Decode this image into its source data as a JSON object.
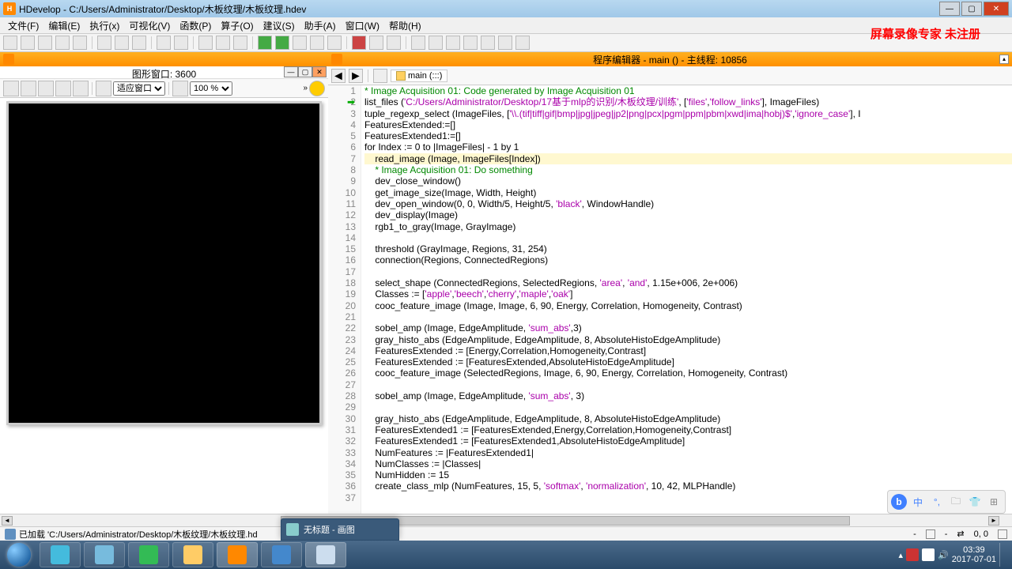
{
  "title": "HDevelop - C:/Users/Administrator/Desktop/木板纹理/木板纹理.hdev",
  "menu": [
    "文件(F)",
    "编辑(E)",
    "执行(x)",
    "可视化(V)",
    "函数(P)",
    "算子(O)",
    "建议(S)",
    "助手(A)",
    "窗口(W)",
    "帮助(H)"
  ],
  "watermark": "屏幕录像专家 未注册",
  "graphic_window": {
    "title": "图形窗口: 3600",
    "fit_label": "适应窗口",
    "zoom": "100 %"
  },
  "editor_header": "程序编辑器 - main ()  - 主线程: 10856",
  "breadcrumb": "main (:::)",
  "code_lines": [
    {
      "n": 1,
      "t": "* Image Acquisition 01: Code generated by Image Acquisition 01",
      "cls": "c-comment"
    },
    {
      "n": 2,
      "t": "list_files ('C:/Users/Administrator/Desktop/17基于mlp的识别/木板纹理/训练', ['files','follow_links'], ImageFiles)",
      "cls": ""
    },
    {
      "n": 3,
      "t": "tuple_regexp_select (ImageFiles, ['\\\\.(tif|tiff|gif|bmp|jpg|jpeg|jp2|png|pcx|pgm|ppm|pbm|xwd|ima|hobj)$','ignore_case'], I",
      "cls": ""
    },
    {
      "n": 4,
      "t": "FeaturesExtended:=[]",
      "cls": ""
    },
    {
      "n": 5,
      "t": "FeaturesExtended1:=[]",
      "cls": ""
    },
    {
      "n": 6,
      "t": "for Index := 0 to |ImageFiles| - 1 by 1",
      "cls": ""
    },
    {
      "n": 7,
      "t": "    read_image (Image, ImageFiles[Index])",
      "cls": "",
      "hl": true
    },
    {
      "n": 8,
      "t": "    * Image Acquisition 01: Do something",
      "cls": "c-comment"
    },
    {
      "n": 9,
      "t": "    dev_close_window()",
      "cls": ""
    },
    {
      "n": 10,
      "t": "    get_image_size(Image, Width, Height)",
      "cls": ""
    },
    {
      "n": 11,
      "t": "    dev_open_window(0, 0, Width/5, Height/5, 'black', WindowHandle)",
      "cls": ""
    },
    {
      "n": 12,
      "t": "    dev_display(Image)",
      "cls": ""
    },
    {
      "n": 13,
      "t": "    rgb1_to_gray(Image, GrayImage)",
      "cls": ""
    },
    {
      "n": 14,
      "t": "",
      "cls": ""
    },
    {
      "n": 15,
      "t": "    threshold (GrayImage, Regions, 31, 254)",
      "cls": ""
    },
    {
      "n": 16,
      "t": "    connection(Regions, ConnectedRegions)",
      "cls": ""
    },
    {
      "n": 17,
      "t": "",
      "cls": ""
    },
    {
      "n": 18,
      "t": "    select_shape (ConnectedRegions, SelectedRegions, 'area', 'and', 1.15e+006, 2e+006)",
      "cls": ""
    },
    {
      "n": 19,
      "t": "    Classes := ['apple','beech','cherry','maple','oak']",
      "cls": ""
    },
    {
      "n": 20,
      "t": "    cooc_feature_image (Image, Image, 6, 90, Energy, Correlation, Homogeneity, Contrast)",
      "cls": ""
    },
    {
      "n": 21,
      "t": "",
      "cls": ""
    },
    {
      "n": 22,
      "t": "    sobel_amp (Image, EdgeAmplitude, 'sum_abs',3)",
      "cls": ""
    },
    {
      "n": 23,
      "t": "    gray_histo_abs (EdgeAmplitude, EdgeAmplitude, 8, AbsoluteHistoEdgeAmplitude)",
      "cls": ""
    },
    {
      "n": 24,
      "t": "    FeaturesExtended := [Energy,Correlation,Homogeneity,Contrast]",
      "cls": ""
    },
    {
      "n": 25,
      "t": "    FeaturesExtended := [FeaturesExtended,AbsoluteHistoEdgeAmplitude]",
      "cls": ""
    },
    {
      "n": 26,
      "t": "    cooc_feature_image (SelectedRegions, Image, 6, 90, Energy, Correlation, Homogeneity, Contrast)",
      "cls": ""
    },
    {
      "n": 27,
      "t": "",
      "cls": ""
    },
    {
      "n": 28,
      "t": "    sobel_amp (Image, EdgeAmplitude, 'sum_abs', 3)",
      "cls": ""
    },
    {
      "n": 29,
      "t": "",
      "cls": ""
    },
    {
      "n": 30,
      "t": "    gray_histo_abs (EdgeAmplitude, EdgeAmplitude, 8, AbsoluteHistoEdgeAmplitude)",
      "cls": ""
    },
    {
      "n": 31,
      "t": "    FeaturesExtended1 := [FeaturesExtended,Energy,Correlation,Homogeneity,Contrast]",
      "cls": ""
    },
    {
      "n": 32,
      "t": "    FeaturesExtended1 := [FeaturesExtended1,AbsoluteHistoEdgeAmplitude]",
      "cls": ""
    },
    {
      "n": 33,
      "t": "    NumFeatures := |FeaturesExtended1|",
      "cls": ""
    },
    {
      "n": 34,
      "t": "    NumClasses := |Classes|",
      "cls": ""
    },
    {
      "n": 35,
      "t": "    NumHidden := 15",
      "cls": ""
    },
    {
      "n": 36,
      "t": "    create_class_mlp (NumFeatures, 15, 5, 'softmax', 'normalization', 10, 42, MLPHandle)",
      "cls": ""
    },
    {
      "n": 37,
      "t": "",
      "cls": ""
    }
  ],
  "status": {
    "text": "已加载 'C:/Users/Administrator/Desktop/木板纹理/木板纹理.hd",
    "dash": "-",
    "coord": "0, 0"
  },
  "preview": {
    "title": "无标题 - 画图"
  },
  "clock": {
    "time": "03:39",
    "date": "2017-07-01"
  },
  "float": {
    "ch": "中"
  },
  "taskbar_icons": [
    "ie",
    "qq",
    "wechat",
    "explorer",
    "hdevelop",
    "wps",
    "paint"
  ]
}
